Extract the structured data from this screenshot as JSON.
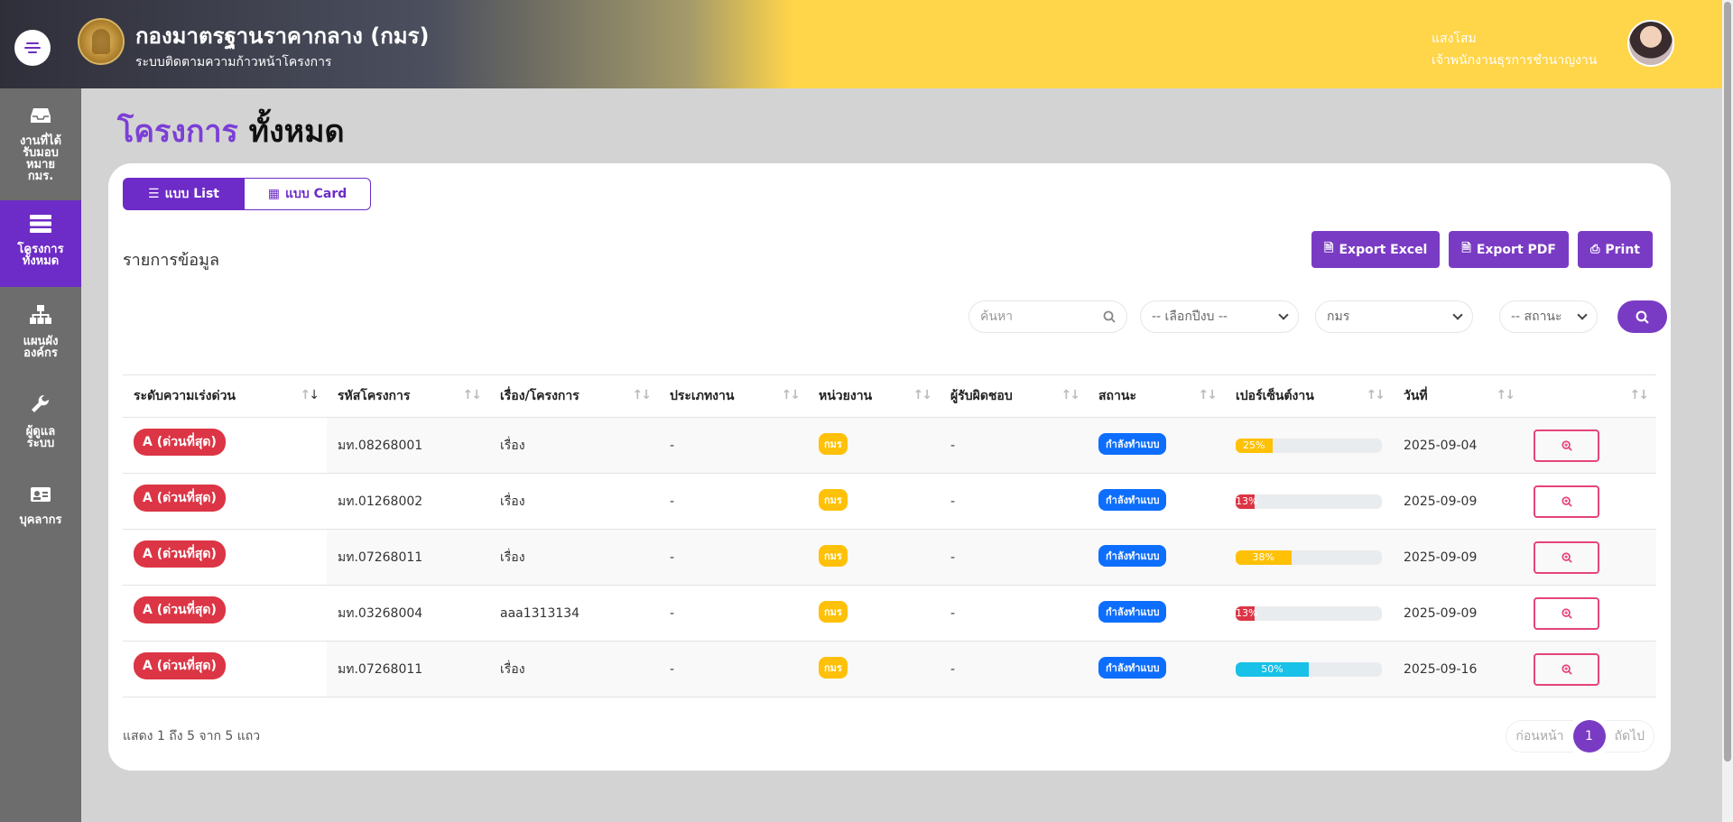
{
  "header": {
    "org_title": "กองมาตรฐานราคากลาง (กมร)",
    "org_subtitle": "ระบบติดตามความก้าวหน้าโครงการ",
    "user_name": "แสงโสม",
    "user_role": "เจ้าพนักงานธุรการชำนาญงาน"
  },
  "sidebar": {
    "items": [
      {
        "label_lines": [
          "งานที่ได้",
          "รับมอบ",
          "หมาย",
          "กมร."
        ],
        "icon": "inbox-icon",
        "active": false
      },
      {
        "label_lines": [
          "โครงการ",
          "ทั้งหมด"
        ],
        "icon": "list-icon",
        "active": true
      },
      {
        "label_lines": [
          "แผนผัง",
          "องค์กร"
        ],
        "icon": "sitemap-icon",
        "active": false
      },
      {
        "label_lines": [
          "ผู้ดูแล",
          "ระบบ"
        ],
        "icon": "wrench-icon",
        "active": false
      },
      {
        "label_lines": [
          "บุคลากร"
        ],
        "icon": "id-card-icon",
        "active": false
      }
    ]
  },
  "page": {
    "title_part1": "โครงการ",
    "title_part2": "ทั้งหมด"
  },
  "view_toggle": {
    "list_label": "แบบ List",
    "card_label": "แบบ Card"
  },
  "section_title": "รายการข้อมูล",
  "exports": {
    "excel": "Export Excel",
    "pdf": "Export PDF",
    "print": "Print"
  },
  "filters": {
    "search_placeholder": "ค้นหา",
    "year_select": "-- เลือกปีงบ --",
    "unit_select": "กมร",
    "status_select": "-- สถานะ"
  },
  "table": {
    "columns": [
      "ระดับความเร่งด่วน",
      "รหัสโครงการ",
      "เรื่อง/โครงการ",
      "ประเภทงาน",
      "หน่วยงาน",
      "ผู้รับผิดชอบ",
      "สถานะ",
      "เปอร์เซ็นต์งาน",
      "วันที่",
      ""
    ],
    "rows": [
      {
        "urgency": "A (ด่วนที่สุด)",
        "code": "มท.08268001",
        "subject": "เรื่อง",
        "type": "-",
        "unit": "กมร",
        "owner": "-",
        "status": "กำลังทำแบบ",
        "percent": 25,
        "percent_label": "25%",
        "percent_color": "#ffc107",
        "date": "2025-09-04"
      },
      {
        "urgency": "A (ด่วนที่สุด)",
        "code": "มท.01268002",
        "subject": "เรื่อง",
        "type": "-",
        "unit": "กมร",
        "owner": "-",
        "status": "กำลังทำแบบ",
        "percent": 13,
        "percent_label": "13%",
        "percent_color": "#dc3545",
        "date": "2025-09-09"
      },
      {
        "urgency": "A (ด่วนที่สุด)",
        "code": "มท.07268011",
        "subject": "เรื่อง",
        "type": "-",
        "unit": "กมร",
        "owner": "-",
        "status": "กำลังทำแบบ",
        "percent": 38,
        "percent_label": "38%",
        "percent_color": "#ffc107",
        "date": "2025-09-09"
      },
      {
        "urgency": "A (ด่วนที่สุด)",
        "code": "มท.03268004",
        "subject": "aaa1313134",
        "type": "-",
        "unit": "กมร",
        "owner": "-",
        "status": "กำลังทำแบบ",
        "percent": 13,
        "percent_label": "13%",
        "percent_color": "#dc3545",
        "date": "2025-09-09"
      },
      {
        "urgency": "A (ด่วนที่สุด)",
        "code": "มท.07268011",
        "subject": "เรื่อง",
        "type": "-",
        "unit": "กมร",
        "owner": "-",
        "status": "กำลังทำแบบ",
        "percent": 50,
        "percent_label": "50%",
        "percent_color": "#17c1e8",
        "date": "2025-09-16"
      }
    ]
  },
  "footer": {
    "info": "แสดง 1 ถึง 5 จาก 5 แถว",
    "prev": "ก่อนหน้า",
    "current": "1",
    "next": "ถัดไป"
  },
  "colors": {
    "accent": "#6d2bc7",
    "urgent": "#dc3545",
    "header_yellow": "#ffd54a"
  }
}
